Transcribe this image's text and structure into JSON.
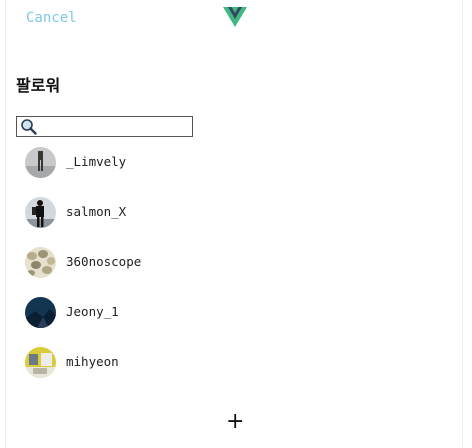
{
  "header": {
    "cancel_label": "Cancel",
    "logo_icon": "vue-logo-icon"
  },
  "title": "팔로워",
  "search": {
    "icon": "magnifier-icon",
    "value": "",
    "placeholder": ""
  },
  "followers": [
    {
      "username": "_Limvely",
      "avatar_icon": "person-standing-photo"
    },
    {
      "username": "salmon_X",
      "avatar_icon": "hiker-silhouette-photo"
    },
    {
      "username": "360noscope",
      "avatar_icon": "pebbles-photo"
    },
    {
      "username": "Jeony_1",
      "avatar_icon": "night-mountain-photo"
    },
    {
      "username": "mihyeon",
      "avatar_icon": "yellow-room-photo"
    }
  ],
  "footer": {
    "add_label": "+"
  },
  "colors": {
    "cancel": "#7fc8e6",
    "logo_outer": "#41b883",
    "logo_inner": "#35495e"
  }
}
